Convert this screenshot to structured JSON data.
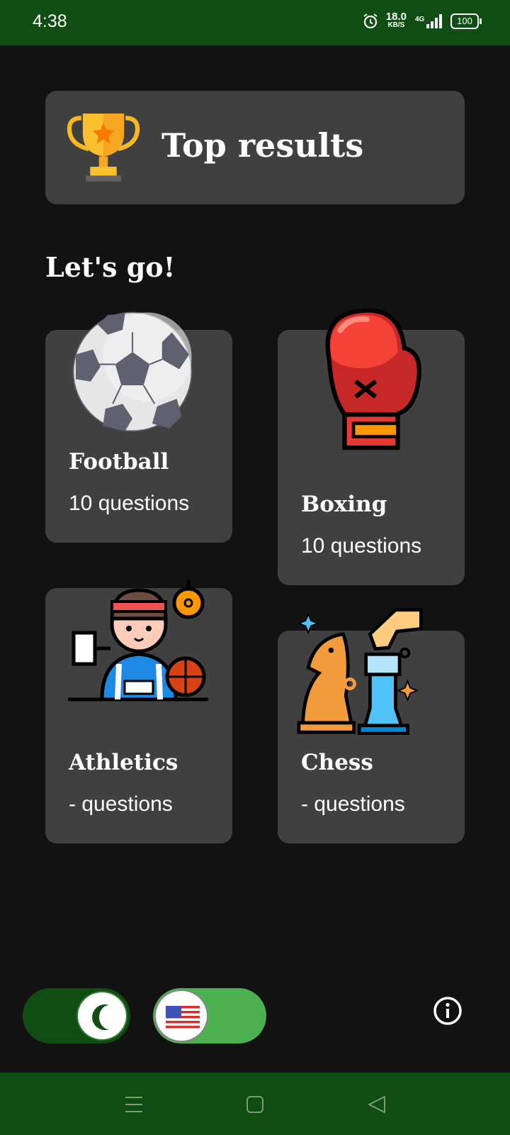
{
  "status_bar": {
    "time": "4:38",
    "net_speed_value": "18.0",
    "net_speed_unit": "KB/S",
    "network_label": "4G",
    "battery": "100"
  },
  "top_results": {
    "title": "Top results",
    "icon": "trophy-icon"
  },
  "section_heading": "Let's go!",
  "categories": [
    {
      "title": "Football",
      "subtitle": "10 questions",
      "icon": "soccer-ball-icon"
    },
    {
      "title": "Boxing",
      "subtitle": "10 questions",
      "icon": "boxing-glove-icon"
    },
    {
      "title": "Athletics",
      "subtitle": "- questions",
      "icon": "athlete-icon"
    },
    {
      "title": "Chess",
      "subtitle": "- questions",
      "icon": "chess-pieces-icon"
    }
  ],
  "controls": {
    "theme_icon": "moon-icon",
    "language_icon": "us-flag-icon",
    "info_icon": "info-icon"
  },
  "colors": {
    "background": "#121212",
    "card": "#404040",
    "bars": "#0f4d12",
    "accent_green": "#4caf50"
  }
}
